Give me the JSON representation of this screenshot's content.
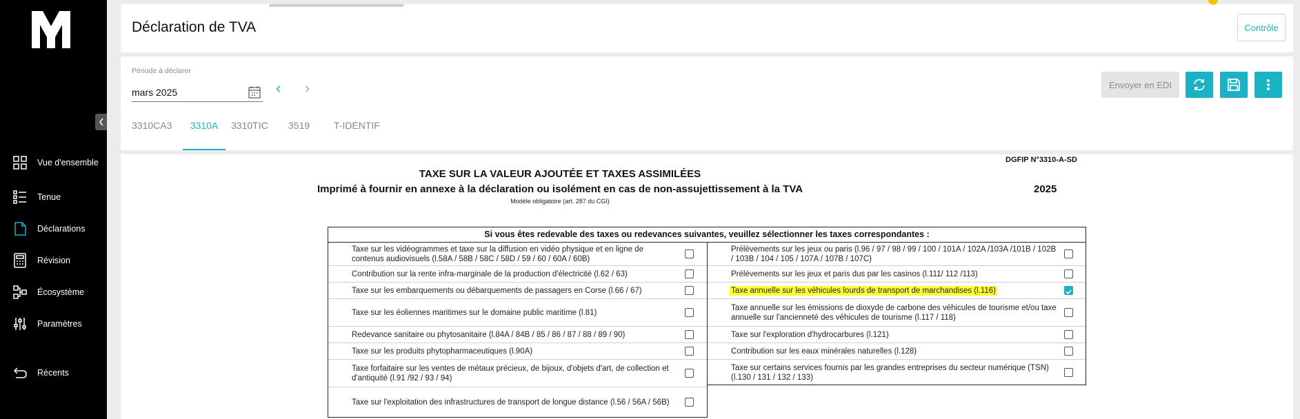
{
  "sidebar": {
    "logo": "logo-icon",
    "items": [
      {
        "label": "Vue d'ensemble",
        "icon": "grid-icon"
      },
      {
        "label": "Tenue",
        "icon": "list-icon"
      },
      {
        "label": "Déclarations",
        "icon": "document-icon"
      },
      {
        "label": "Révision",
        "icon": "calculator-icon"
      },
      {
        "label": "Écosystème",
        "icon": "network-icon"
      },
      {
        "label": "Paramètres",
        "icon": "sliders-icon"
      },
      {
        "label": "Récents",
        "icon": "undo-icon"
      }
    ]
  },
  "header": {
    "title": "Déclaration de TVA",
    "controle_label": "Contrôle"
  },
  "period": {
    "label": "Période à déclarer",
    "value": "mars 2025",
    "prev_arrow": "‹",
    "next_arrow": "›"
  },
  "tabs": [
    "3310CA3",
    "3310A",
    "3310TIC",
    "3519",
    "T-IDENTIF"
  ],
  "active_tab": "3310A",
  "actions": {
    "edi_label": "Envoyer en EDI",
    "refresh_icon": "refresh-icon",
    "save_icon": "save-icon",
    "more_icon": "more-vertical-icon"
  },
  "form": {
    "ref": "DGFIP N°3310-A-SD",
    "title": "TAXE SUR LA VALEUR AJOUTÉE ET TAXES ASSIMILÉES",
    "subtitle": "Imprimé à fournir en annexe à la déclaration ou isolément en cas de non-assujettissement à la TVA",
    "note": "Modèle obligatoire (art. 287 du CGI)",
    "year": "2025",
    "grid_header": "Si vous êtes redevable des taxes ou redevances suivantes, veuillez sélectionner les taxes correspondantes :",
    "left": [
      {
        "text": "Taxe sur les vidéogrammes et taxe sur la diffusion en vidéo physique et en ligne de contenus audiovisuels (l.58A / 58B / 58C / 58D / 59 / 60 / 60A / 60B)",
        "checked": false
      },
      {
        "text": "Contribution sur la rente infra-marginale de la production d'électricité (l.62 / 63)",
        "checked": false
      },
      {
        "text": "Taxe sur les embarquements ou débarquements de passagers en Corse (l.66 / 67)",
        "checked": false
      },
      {
        "text": "Taxe sur les éoliennes maritimes sur le domaine public maritime (l.81)",
        "checked": false
      },
      {
        "text": "Redevance sanitaire ou phytosanitaire (l.84A / 84B / 85 / 86 / 87 / 88 / 89 / 90)",
        "checked": false
      },
      {
        "text": "Taxe sur les produits phytopharmaceutiques (l.90A)",
        "checked": false
      },
      {
        "text": "Taxe forfaitaire sur les ventes de métaux précieux, de bijoux, d'objets d'art, de collection et d'antiquité (l.91 /92 / 93 / 94)",
        "checked": false
      },
      {
        "text": "Taxe sur l'exploitation des infrastructures de transport de longue distance (l.56 / 56A / 56B)",
        "checked": false
      }
    ],
    "right": [
      {
        "text": "Prélèvements sur les jeux ou paris (l.96 / 97 / 98 / 99 / 100 / 101A / 102A /103A /101B / 102B / 103B / 104 / 105 / 107A / 107B / 107C)",
        "checked": false
      },
      {
        "text": "Prélèvements sur les jeux et paris dus par les casinos (l.111/ 112 /113)",
        "checked": false
      },
      {
        "text": "Taxe annuelle sur les véhicules lourds de transport de marchandises (l.116)",
        "checked": true,
        "highlight": true
      },
      {
        "text": "Taxe annuelle sur les émissions de dioxyde de carbone des véhicules de tourisme et/ou taxe annuelle sur l'ancienneté des véhicules de tourisme (l.117 / 118)",
        "checked": false
      },
      {
        "text": "Taxe sur l'exploration d'hydrocarbures (l.121)",
        "checked": false
      },
      {
        "text": "Contribution sur les eaux minérales naturelles (l.128)",
        "checked": false
      },
      {
        "text": "Taxe sur certains services fournis par les grandes entreprises du secteur numérique (TSN) (l.130 / 131 / 132 / 133)",
        "checked": false
      }
    ]
  },
  "colors": {
    "accent": "#1ab3c4",
    "highlight": "#ffff33"
  }
}
